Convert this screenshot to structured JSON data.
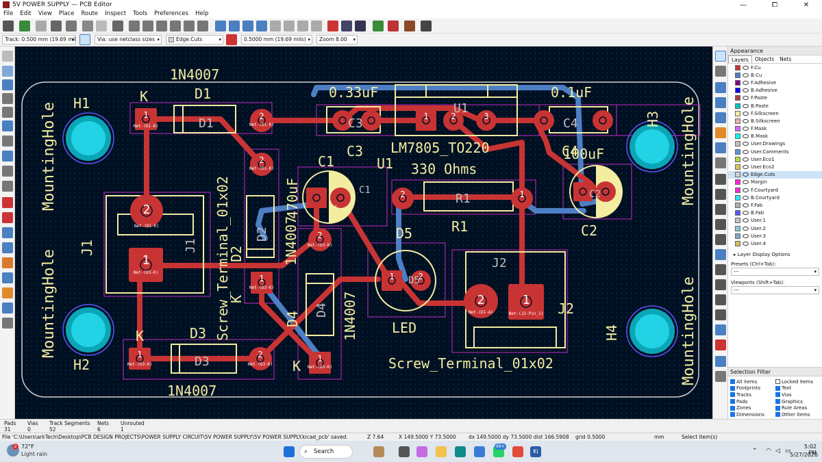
{
  "window": {
    "title": "5V POWER SUPPLY — PCB Editor",
    "minimize": "—",
    "maximize": "⧠",
    "close": "✕"
  },
  "menu": [
    "File",
    "Edit",
    "View",
    "Place",
    "Route",
    "Inspect",
    "Tools",
    "Preferences",
    "Help"
  ],
  "options": {
    "track": "Track: 0.500 mm (19.69 mils)",
    "via": "Via: use netclass sizes",
    "layer": "Edge.Cuts",
    "width": "0.5000 mm (19.69 mils)",
    "zoom": "Zoom 8.00"
  },
  "pcb": {
    "labels": {
      "h1": "H1",
      "h2": "H2",
      "h3": "H3",
      "h4": "H4",
      "mh": "MountingHole",
      "d1_val": "1N4007",
      "d1_ref": "D1",
      "d1_fab": "D1",
      "k": "K",
      "d2_val": "1N4007",
      "d2_ref": "D2",
      "d2_fab": "D2",
      "d3_val": "1N4007",
      "d3_ref": "D3",
      "d3_fab": "D3",
      "d4_val": "1N4007",
      "d4_ref": "D4",
      "d4_fab": "D4",
      "c3_val": "0.33uF",
      "c3_ref": "C3",
      "c3_fab": "C3",
      "c4_val": "0.1uF",
      "c4_ref": "C4",
      "c4_fab": "C4",
      "u1_val": "LM7805_TO220",
      "u1_ref": "U1",
      "u1_fab": "U1",
      "c1_val": "470uF",
      "c1_ref": "C1",
      "c1_fab": "C1",
      "c2_val": "100uF",
      "c2_ref": "C2",
      "c2_fab": "C2",
      "r1_val": "330 Ohms",
      "r1_ref": "R1",
      "r1_fab": "R1",
      "d5_ref": "D5",
      "d5_val": "LED",
      "d5_fab": "D5",
      "j1_ref": "J1",
      "j1_val": "Screw_Terminal_01x02",
      "j1_fab": "J1",
      "j2_ref": "J2",
      "j2_val": "Screw_Terminal_01x02",
      "j2_fab": "J2",
      "p1": "1",
      "p2": "2",
      "p3": "3",
      "plus": "+",
      "net_d1k": "Net-(D1-K)",
      "net_d3k": "Net-(D3-K)",
      "net_d1a": "Net-(D1-A)",
      "net_j2": "Net-(J2-Pin_1)"
    }
  },
  "appearance": {
    "title": "Appearance",
    "tabs": [
      "Layers",
      "Objects",
      "Nets"
    ],
    "layers": [
      {
        "name": "F.Cu",
        "color": "#c83434"
      },
      {
        "name": "B.Cu",
        "color": "#4d7fc4"
      },
      {
        "name": "F.Adhesive",
        "color": "#840084"
      },
      {
        "name": "B.Adhesive",
        "color": "#0000ff"
      },
      {
        "name": "F.Paste",
        "color": "#b04141"
      },
      {
        "name": "B.Paste",
        "color": "#00c2c2"
      },
      {
        "name": "F.Silkscreen",
        "color": "#f2eda1"
      },
      {
        "name": "B.Silkscreen",
        "color": "#e8b2a7"
      },
      {
        "name": "F.Mask",
        "color": "#d864ff"
      },
      {
        "name": "B.Mask",
        "color": "#02ffee"
      },
      {
        "name": "User.Drawings",
        "color": "#c2c2c2"
      },
      {
        "name": "User.Comments",
        "color": "#5994dc"
      },
      {
        "name": "User.Eco1",
        "color": "#b4db46"
      },
      {
        "name": "User.Eco2",
        "color": "#d8c852"
      },
      {
        "name": "Edge.Cuts",
        "color": "#d0d2cd"
      },
      {
        "name": "Margin",
        "color": "#ff26e2"
      },
      {
        "name": "F.Courtyard",
        "color": "#ff26e2"
      },
      {
        "name": "B.Courtyard",
        "color": "#26e9ff"
      },
      {
        "name": "F.Fab",
        "color": "#afafaf"
      },
      {
        "name": "B.Fab",
        "color": "#5858ff"
      },
      {
        "name": "User.1",
        "color": "#c2c2c2"
      },
      {
        "name": "User.2",
        "color": "#89cdd4"
      },
      {
        "name": "User.3",
        "color": "#7da6c8"
      },
      {
        "name": "User.4",
        "color": "#d0c060"
      }
    ],
    "selected_layer": "Edge.Cuts",
    "layer_display_options": "Layer Display Options",
    "presets_label": "Presets (Ctrl+Tab):",
    "presets_value": "---",
    "viewports_label": "Viewports (Shift+Tab):",
    "viewports_value": "---"
  },
  "selection_filter": {
    "title": "Selection Filter",
    "items": [
      {
        "label": "All items",
        "checked": true
      },
      {
        "label": "Locked items",
        "checked": false
      },
      {
        "label": "Footprints",
        "checked": true
      },
      {
        "label": "Text",
        "checked": true
      },
      {
        "label": "Tracks",
        "checked": true
      },
      {
        "label": "Vias",
        "checked": true
      },
      {
        "label": "Pads",
        "checked": true
      },
      {
        "label": "Graphics",
        "checked": true
      },
      {
        "label": "Zones",
        "checked": true
      },
      {
        "label": "Rule Areas",
        "checked": true
      },
      {
        "label": "Dimensions",
        "checked": true
      },
      {
        "label": "Other items",
        "checked": true
      }
    ]
  },
  "stats": [
    {
      "label": "Pads",
      "value": "31"
    },
    {
      "label": "Vias",
      "value": "0"
    },
    {
      "label": "Track Segments",
      "value": "52"
    },
    {
      "label": "Nets",
      "value": "6"
    },
    {
      "label": "Unrouted",
      "value": "1"
    }
  ],
  "status": {
    "message": "File 'C:\\Users\\arkTech\\Desktop\\PCB DESIGN PROJECTS\\POWER SUPPLY CIRCUIT\\5V POWER SUPPLY\\5V POWER SUPPLY.kicad_pcb' saved.",
    "z": "Z 7.64",
    "xy": "X 149.5000  Y 73.5000",
    "dxy": "dx 149.5000  dy 73.5000  dist 166.5908",
    "grid": "grid 0.5000",
    "units": "mm",
    "action": "Select item(s)"
  },
  "taskbar": {
    "weather_temp": "72°F",
    "weather_desc": "Light rain",
    "weather_badge": "2",
    "search": "Search",
    "badge": "99+",
    "time": "5:02 PM",
    "date": "5/27/2026"
  }
}
